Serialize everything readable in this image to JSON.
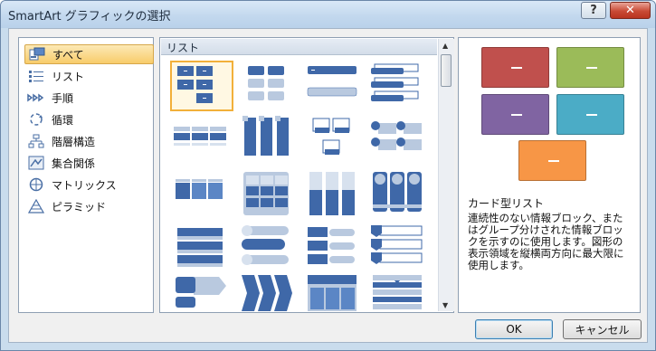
{
  "window": {
    "title": "SmartArt グラフィックの選択",
    "help_icon": "?",
    "close_icon": "✕"
  },
  "categories": [
    {
      "label": "すべて",
      "icon": "all-icon",
      "selected": true
    },
    {
      "label": "リスト",
      "icon": "list-icon"
    },
    {
      "label": "手順",
      "icon": "process-icon"
    },
    {
      "label": "循環",
      "icon": "cycle-icon"
    },
    {
      "label": "階層構造",
      "icon": "hierarchy-icon"
    },
    {
      "label": "集合関係",
      "icon": "relationship-icon"
    },
    {
      "label": "マトリックス",
      "icon": "matrix-icon"
    },
    {
      "label": "ピラミッド",
      "icon": "pyramid-icon"
    }
  ],
  "gallery": {
    "header": "リスト",
    "selected_index": 0
  },
  "preview": {
    "title": "カード型リスト",
    "description": "連続性のない情報ブロック、またはグループ分けされた情報ブロックを示すのに使用します。図形の表示領域を縦横両方向に最大限に使用します。",
    "colors": [
      "#c0504d",
      "#9bbb59",
      "#8064a2",
      "#4bacc6",
      "#f79646"
    ]
  },
  "buttons": {
    "ok": "OK",
    "cancel": "キャンセル"
  },
  "colors": {
    "accent": "#3f68a8",
    "light": "#b9c9df",
    "selection": "#f2b03a"
  }
}
